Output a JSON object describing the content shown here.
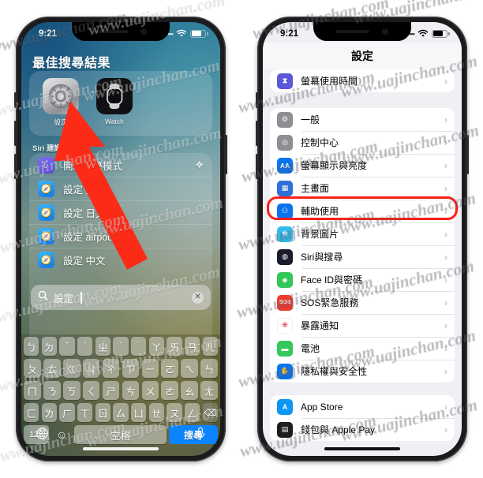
{
  "meta": {
    "watermark_text": "www.uajinchan.com",
    "accent_blue": "#0a84ff",
    "highlight_red": "#ff1f17"
  },
  "left_phone": {
    "status_bar": {
      "time": "9:21",
      "wifi_icon": "wifi-icon",
      "battery_icon": "battery-icon"
    },
    "spotlight": {
      "heading": "最佳搜尋結果",
      "top_results": [
        {
          "label": "設定",
          "icon": "settings-gear-icon"
        },
        {
          "label": "Watch",
          "icon": "watch-app-icon"
        }
      ],
      "siri_heading": "Siri 建議",
      "suggestions": [
        {
          "label": "開啟勿擾模式",
          "icon": "moon-icon",
          "trailing_icon": "layers-icon"
        },
        {
          "label": "設定 英文",
          "icon": "safari-icon",
          "trailing_icon": ""
        },
        {
          "label": "設定 日文",
          "icon": "safari-icon",
          "trailing_icon": ""
        },
        {
          "label": "設定 airpods",
          "icon": "safari-icon",
          "trailing_icon": ""
        },
        {
          "label": "設定 中文",
          "icon": "safari-icon",
          "trailing_icon": ""
        }
      ]
    },
    "search": {
      "icon": "search-icon",
      "value": "設定",
      "placeholder": "搜尋",
      "clear_icon": "clear-circle-icon"
    },
    "keyboard": {
      "layout_name": "zhuyin",
      "rows": [
        [
          "ㄅ",
          "ㄉ",
          "ˇ",
          "ˋ",
          "ㄓ",
          "ˊ",
          "˙",
          "ㄚ",
          "ㄞ",
          "ㄢ",
          "ㄦ"
        ],
        [
          "ㄆ",
          "ㄊ",
          "ㄍ",
          "ㄐ",
          "ㄔ",
          "ㄗ",
          "ㄧ",
          "ㄛ",
          "ㄟ",
          "ㄣ"
        ],
        [
          "ㄇ",
          "ㄋ",
          "ㄎ",
          "ㄑ",
          "ㄕ",
          "ㄘ",
          "ㄨ",
          "ㄜ",
          "ㄠ",
          "ㄤ"
        ],
        [
          "ㄈ",
          "ㄌ",
          "ㄏ",
          "ㄒ",
          "ㄖ",
          "ㄙ",
          "ㄩ",
          "ㄝ",
          "ㄡ",
          "ㄥ"
        ]
      ],
      "delete_key": "⌫",
      "number_key": "123",
      "emoji_key": "emoji-icon",
      "space_key": "空格",
      "search_key": "搜尋",
      "globe_key": "globe-icon",
      "mic_key": "microphone-icon"
    }
  },
  "right_phone": {
    "status_bar": {
      "time": "9:21",
      "wifi_icon": "wifi-icon",
      "battery_icon": "battery-icon"
    },
    "nav": {
      "title": "設定"
    },
    "groups": [
      {
        "rows": [
          {
            "label": "螢幕使用時間",
            "icon": "screentime-icon",
            "icon_class": "ic-screentime",
            "glyph": "⧖",
            "highlight": false
          }
        ]
      },
      {
        "rows": [
          {
            "label": "一般",
            "icon": "general-gear-icon",
            "icon_class": "ic-general",
            "glyph": "⚙",
            "highlight": false
          },
          {
            "label": "控制中心",
            "icon": "control-center-icon",
            "icon_class": "ic-control",
            "glyph": "◉",
            "highlight": false
          },
          {
            "label": "螢幕顯示與亮度",
            "icon": "display-brightness-icon",
            "icon_class": "ic-display",
            "glyph": "AA",
            "highlight": false
          },
          {
            "label": "主畫面",
            "icon": "home-screen-icon",
            "icon_class": "ic-home",
            "glyph": "▦",
            "highlight": false
          },
          {
            "label": "輔助使用",
            "icon": "accessibility-icon",
            "icon_class": "ic-access",
            "glyph": "⚇",
            "highlight": true
          },
          {
            "label": "背景圖片",
            "icon": "wallpaper-icon",
            "icon_class": "ic-wallpaper",
            "glyph": "✽",
            "highlight": false
          },
          {
            "label": "Siri與搜尋",
            "icon": "siri-icon",
            "icon_class": "ic-siri",
            "glyph": "◍",
            "highlight": false
          },
          {
            "label": "Face ID與密碼",
            "icon": "faceid-icon",
            "icon_class": "ic-faceid",
            "glyph": "☺",
            "highlight": false
          },
          {
            "label": "SOS緊急服務",
            "icon": "emergency-sos-icon",
            "icon_class": "ic-sos",
            "glyph": "SOS",
            "highlight": false
          },
          {
            "label": "暴露通知",
            "icon": "exposure-notification-icon",
            "icon_class": "ic-exposure",
            "glyph": "❋",
            "highlight": false
          },
          {
            "label": "電池",
            "icon": "battery-settings-icon",
            "icon_class": "ic-battery",
            "glyph": "▭",
            "highlight": false
          },
          {
            "label": "隱私權與安全性",
            "icon": "privacy-hand-icon",
            "icon_class": "ic-privacy",
            "glyph": "✋",
            "highlight": false
          }
        ]
      },
      {
        "rows": [
          {
            "label": "App Store",
            "icon": "app-store-icon",
            "icon_class": "ic-appstore",
            "glyph": "Ⓐ",
            "highlight": false
          },
          {
            "label": "錢包與 Apple Pay",
            "icon": "wallet-icon",
            "icon_class": "ic-wallet",
            "glyph": "▤",
            "highlight": false
          }
        ]
      }
    ],
    "chevron": "›"
  }
}
